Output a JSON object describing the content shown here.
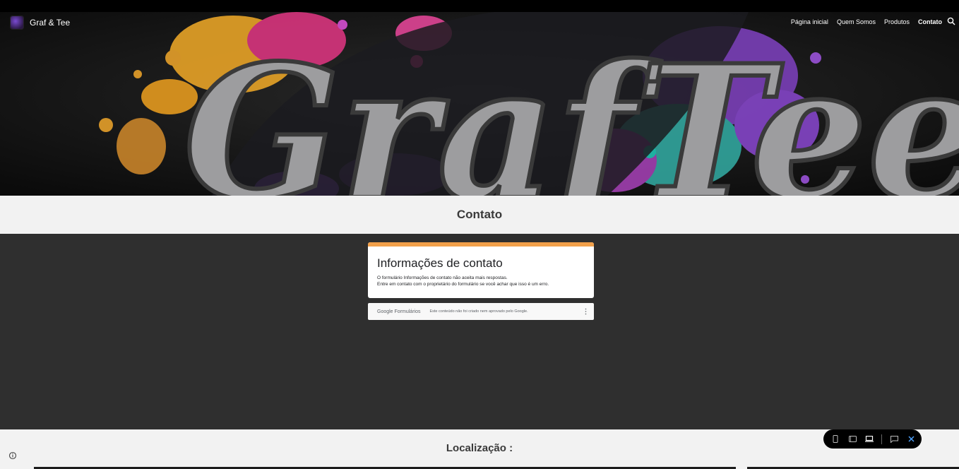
{
  "site": {
    "title": "Graf & Tee"
  },
  "nav": {
    "items": [
      {
        "label": "Página inicial",
        "active": false
      },
      {
        "label": "Quem Somos",
        "active": false
      },
      {
        "label": "Produtos",
        "active": false
      },
      {
        "label": "Contato",
        "active": true
      }
    ]
  },
  "hero": {
    "brand_text": "GrafTee"
  },
  "contact_band": {
    "title": "Contato"
  },
  "form": {
    "heading": "Informações de contato",
    "message_line1": "O formulário Informações de contato não aceita mais respostas.",
    "message_line2": "Entre em contato com o proprietário do formulário se você achar que isso é um erro.",
    "footer_google": "Google",
    "footer_forms": "Formulários",
    "footer_note": "Este conteúdo não foi criado nem aprovado pelo Google."
  },
  "location_band": {
    "title": "Localização :"
  },
  "colors": {
    "accent": "#f2a04a",
    "band_bg": "#f2f2f2",
    "main_bg": "#2f2f2f"
  },
  "icons": [
    "search-icon",
    "more-vert-icon",
    "phone-icon",
    "tablet-icon",
    "laptop-icon",
    "feedback-icon",
    "close-icon",
    "info-icon"
  ]
}
